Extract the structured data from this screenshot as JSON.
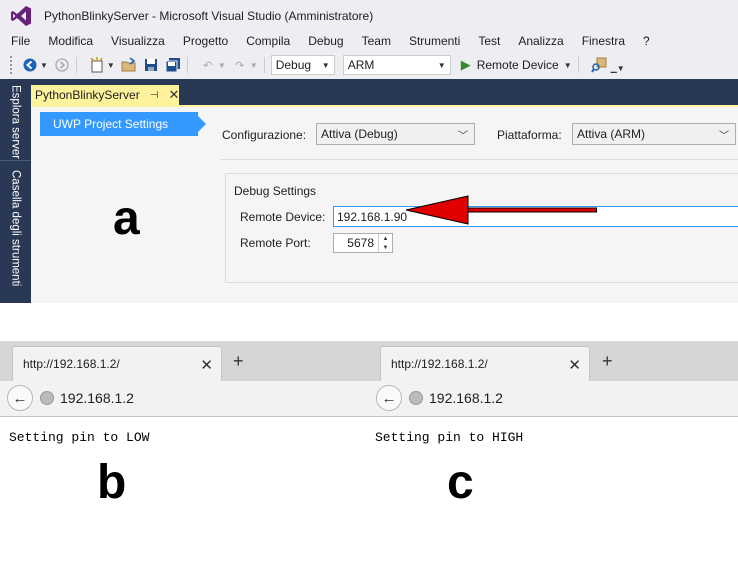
{
  "vs": {
    "window_title": "PythonBlinkyServer - Microsoft Visual Studio (Amministratore)",
    "menu": [
      "File",
      "Modifica",
      "Visualizza",
      "Progetto",
      "Compila",
      "Debug",
      "Team",
      "Strumenti",
      "Test",
      "Analizza",
      "Finestra",
      "?"
    ],
    "toolbar": {
      "config_combo": "Debug",
      "platform_combo": "ARM",
      "run_label": "Remote Device"
    },
    "side_tabs": [
      "Esplora server",
      "Casella degli strumenti"
    ],
    "document_tab": "PythonBlinkyServer",
    "nav_item": "UWP Project Settings",
    "configuration": {
      "label": "Configurazione:",
      "value": "Attiva (Debug)"
    },
    "platform": {
      "label": "Piattaforma:",
      "value": "Attiva (ARM)"
    },
    "debug_settings": {
      "title": "Debug Settings",
      "remote_device_label": "Remote Device:",
      "remote_device_value": "192.168.1.90",
      "remote_port_label": "Remote Port:",
      "remote_port_value": "5678"
    },
    "accent_color": "#3399ff"
  },
  "panel_letters": {
    "a": "a",
    "b": "b",
    "c": "c"
  },
  "browser_b": {
    "tab_title": "http://192.168.1.2/",
    "url": "192.168.1.2",
    "content": "Setting pin to LOW"
  },
  "browser_c": {
    "tab_title": "http://192.168.1.2/",
    "url": "192.168.1.2",
    "content": "Setting pin to HIGH"
  }
}
